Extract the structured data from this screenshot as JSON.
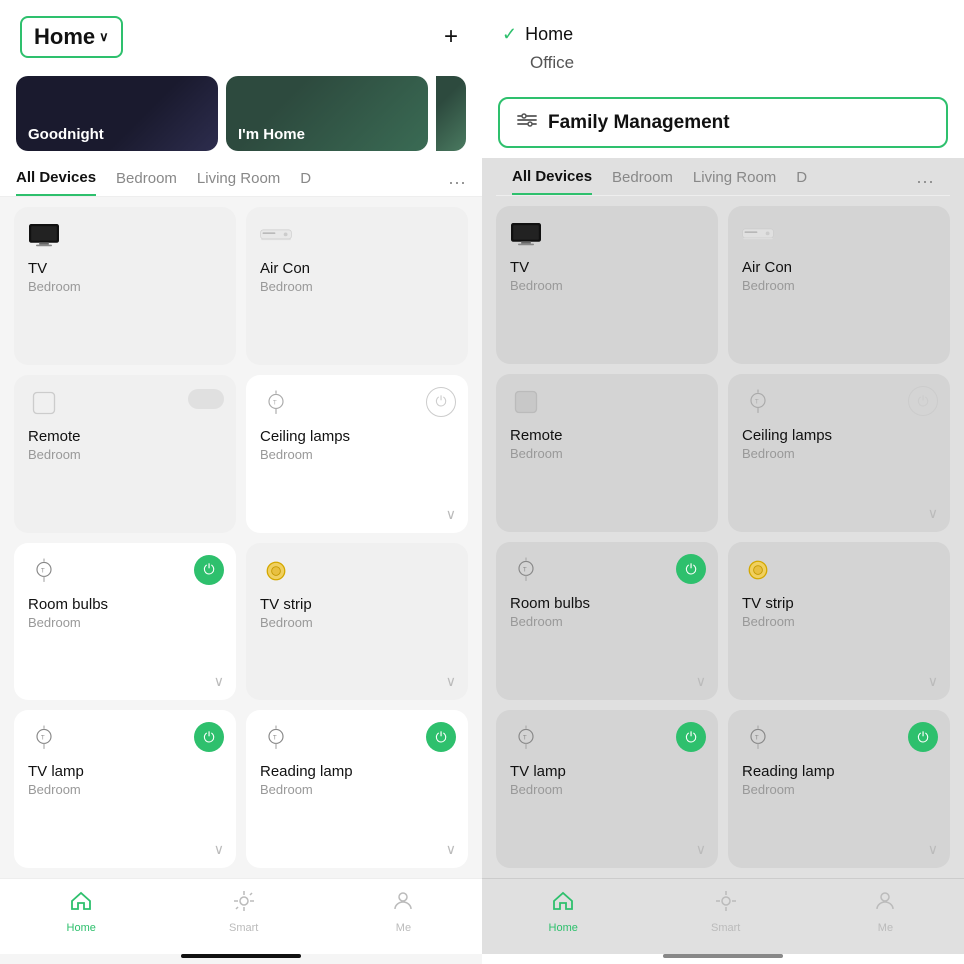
{
  "left": {
    "header": {
      "title": "Home",
      "chevron": "∨",
      "add_btn": "+"
    },
    "scenes": [
      {
        "label": "Goodnight",
        "type": "goodnight"
      },
      {
        "label": "I'm Home",
        "type": "imhome"
      }
    ],
    "tabs": [
      {
        "label": "All Devices",
        "active": true
      },
      {
        "label": "Bedroom",
        "active": false
      },
      {
        "label": "Living Room",
        "active": false
      },
      {
        "label": "D",
        "active": false
      }
    ],
    "devices": [
      {
        "name": "TV",
        "room": "Bedroom",
        "icon": "tv",
        "has_power": false,
        "power_on": false
      },
      {
        "name": "Air Con",
        "room": "Bedroom",
        "icon": "aircon",
        "has_power": false,
        "power_on": false
      },
      {
        "name": "Remote",
        "room": "Bedroom",
        "icon": "remote",
        "has_power": false,
        "power_on": false,
        "has_toggle": true
      },
      {
        "name": "Ceiling lamps",
        "room": "Bedroom",
        "icon": "bulb",
        "has_power": true,
        "power_on": false,
        "has_chevron": true,
        "has_toggle": false,
        "power_off_style": true
      },
      {
        "name": "Room bulbs",
        "room": "Bedroom",
        "icon": "bulb",
        "has_power": true,
        "power_on": true,
        "has_chevron": true
      },
      {
        "name": "TV strip",
        "room": "Bedroom",
        "icon": "strip",
        "has_power": false,
        "power_on": false,
        "has_chevron": true
      },
      {
        "name": "TV lamp",
        "room": "Bedroom",
        "icon": "bulb",
        "has_power": true,
        "power_on": true,
        "has_chevron": true
      },
      {
        "name": "Reading lamp",
        "room": "Bedroom",
        "icon": "bulb",
        "has_power": true,
        "power_on": true,
        "has_chevron": true
      }
    ],
    "bottom_nav": [
      {
        "label": "Home",
        "icon": "home",
        "active": true
      },
      {
        "label": "Smart",
        "icon": "smart",
        "active": false
      },
      {
        "label": "Me",
        "icon": "me",
        "active": false
      }
    ]
  },
  "right": {
    "menu_items": [
      {
        "label": "Home",
        "checked": true
      },
      {
        "label": "Office",
        "checked": false
      }
    ],
    "family_management": {
      "label": "Family Management",
      "icon": "settings"
    },
    "tabs": [
      {
        "label": "All Devices",
        "active": true
      },
      {
        "label": "Bedroom",
        "active": false
      },
      {
        "label": "Living Room",
        "active": false
      },
      {
        "label": "D",
        "active": false
      }
    ],
    "devices": [
      {
        "name": "TV",
        "room": "Bedroom",
        "icon": "tv",
        "has_power": false,
        "power_on": false
      },
      {
        "name": "Air Con",
        "room": "Bedroom",
        "icon": "aircon",
        "has_power": false,
        "power_on": false
      },
      {
        "name": "Remote",
        "room": "Bedroom",
        "icon": "remote",
        "has_power": false,
        "power_on": false
      },
      {
        "name": "Ceiling lamps",
        "room": "Bedroom",
        "icon": "bulb",
        "has_power": true,
        "power_on": false,
        "has_chevron": true,
        "power_off_style": true
      },
      {
        "name": "Room bulbs",
        "room": "Bedroom",
        "icon": "bulb",
        "has_power": true,
        "power_on": true,
        "has_chevron": true
      },
      {
        "name": "TV strip",
        "room": "Bedroom",
        "icon": "strip",
        "has_power": false,
        "power_on": false,
        "has_chevron": true
      },
      {
        "name": "TV lamp",
        "room": "Bedroom",
        "icon": "bulb",
        "has_power": true,
        "power_on": true,
        "has_chevron": true
      },
      {
        "name": "Reading lamp",
        "room": "Bedroom",
        "icon": "bulb",
        "has_power": true,
        "power_on": true,
        "has_chevron": true
      }
    ],
    "bottom_nav": [
      {
        "label": "Home",
        "icon": "home",
        "active": true
      },
      {
        "label": "Smart",
        "icon": "smart",
        "active": false
      },
      {
        "label": "Me",
        "icon": "me",
        "active": false
      }
    ]
  }
}
